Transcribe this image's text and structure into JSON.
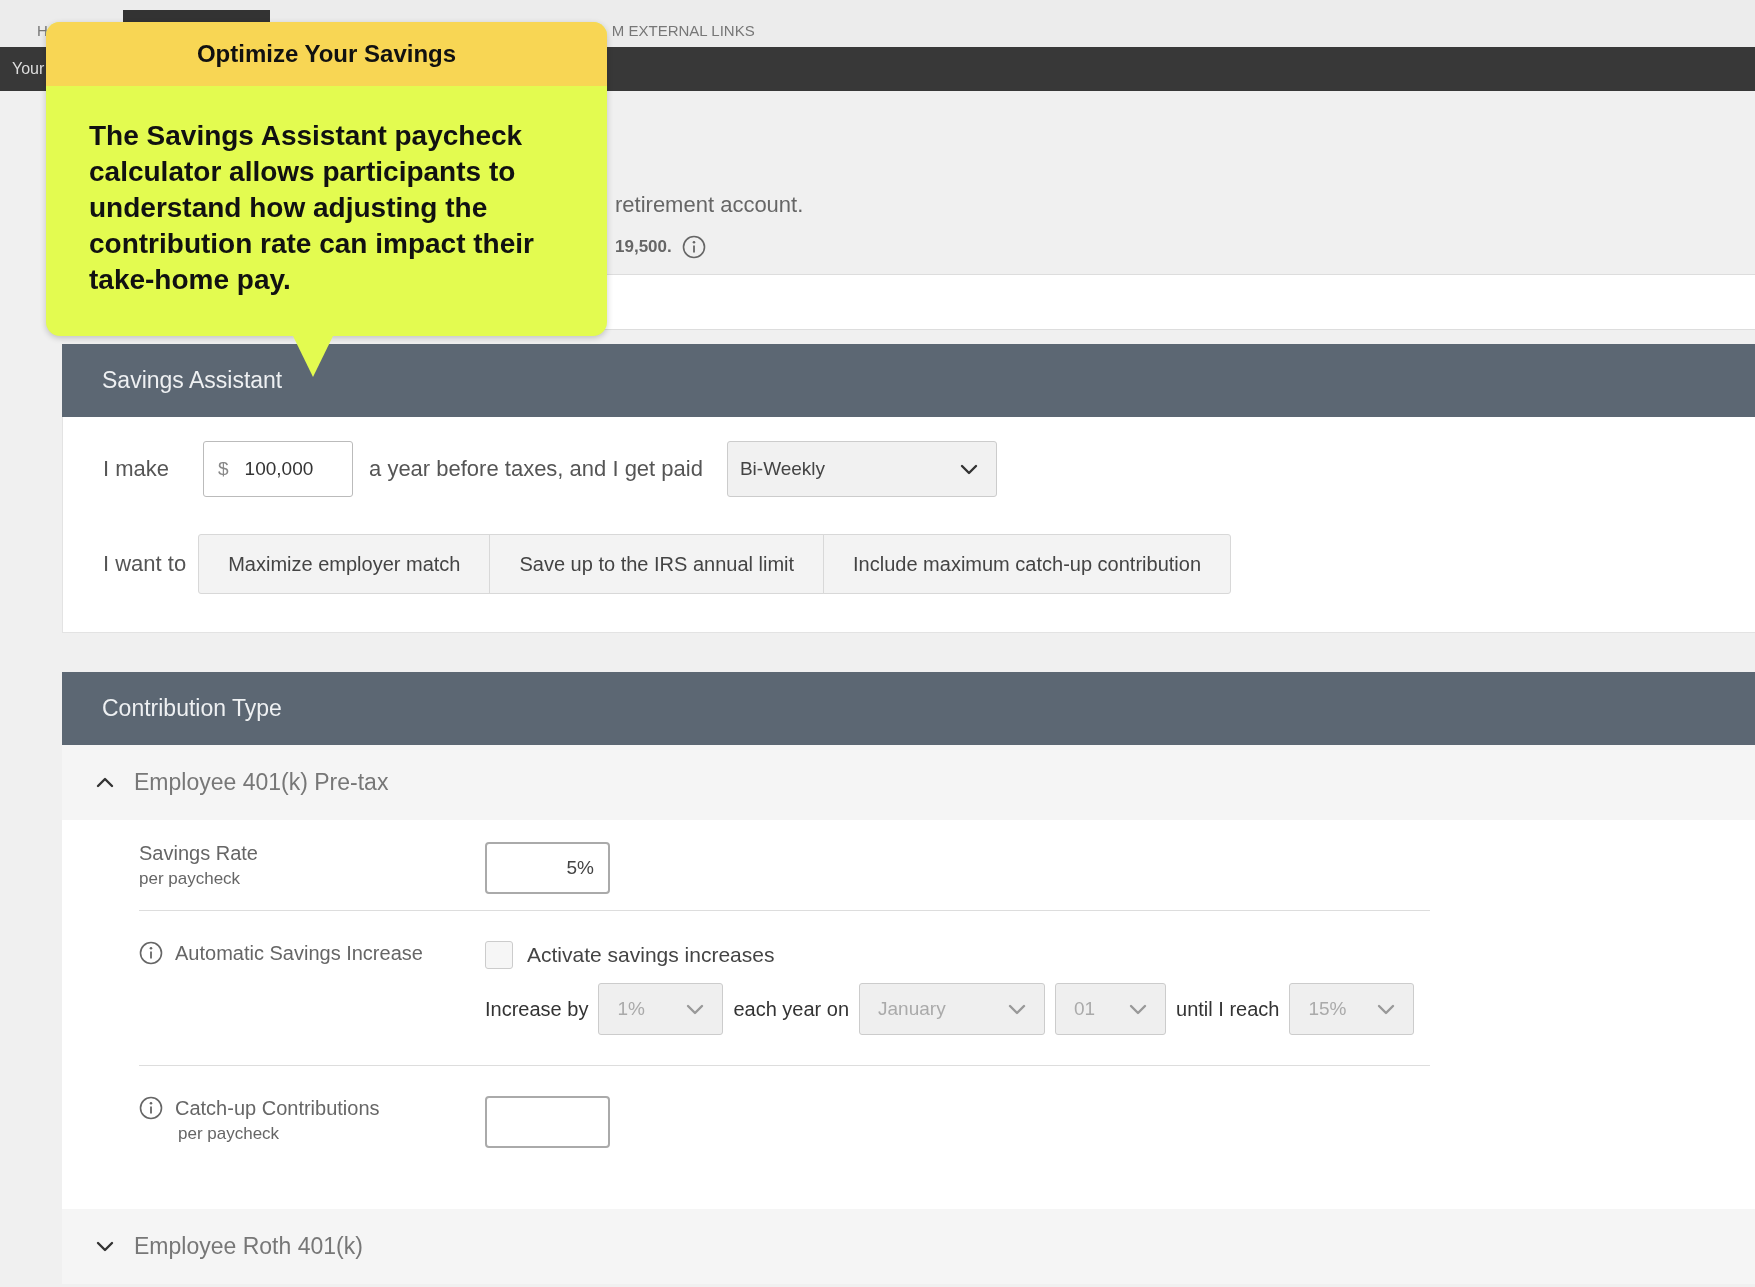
{
  "top_nav": {
    "items": [
      {
        "label": "H",
        "selected": false
      },
      {
        "selected": true
      },
      {
        "label": "M EXTERNAL LINKS",
        "selected": false
      }
    ]
  },
  "sub_bar": {
    "text": "Your"
  },
  "intro": {
    "text": "retirement account.",
    "limit": "19,500."
  },
  "callout": {
    "title": "Optimize Your Savings",
    "body": "The Savings Assistant paycheck calculator allows participants to understand how adjusting the contribution rate can impact their take-home pay."
  },
  "savings_assistant": {
    "title": "Savings Assistant",
    "income_label": "I make",
    "currency": "$",
    "income": "100,000",
    "income_suffix": "a year before taxes, and I get paid",
    "frequency": "Bi-Weekly",
    "goal_label": "I want to",
    "goals": [
      {
        "label": "Maximize employer match",
        "selected": false
      },
      {
        "label": "Save up to the IRS annual limit",
        "selected": false
      },
      {
        "label": "Include maximum catch-up contribution",
        "selected": false
      }
    ]
  },
  "contribution_type": {
    "title": "Contribution Type",
    "sections": [
      {
        "title": "Employee 401(k) Pre-tax",
        "expanded": true,
        "savings_rate": {
          "label": "Savings Rate",
          "sublabel": "per paycheck",
          "value": "5%"
        },
        "auto_increase": {
          "label": "Automatic Savings Increase",
          "checkbox": {
            "label": "Activate savings increases",
            "checked": false
          },
          "parts": [
            {
              "kind": "text",
              "text": "Increase by"
            },
            {
              "kind": "select",
              "value": "1%",
              "disabled": true
            },
            {
              "kind": "text",
              "text": "each year on"
            },
            {
              "kind": "select",
              "value": "January",
              "disabled": true
            },
            {
              "kind": "select",
              "value": "01",
              "disabled": true
            },
            {
              "kind": "text",
              "text": "until I reach"
            },
            {
              "kind": "select",
              "value": "15%",
              "disabled": true
            }
          ]
        },
        "catch_up": {
          "label": "Catch-up Contributions",
          "sublabel": "per paycheck"
        }
      },
      {
        "title": "Employee Roth 401(k)",
        "expanded": false
      }
    ]
  }
}
